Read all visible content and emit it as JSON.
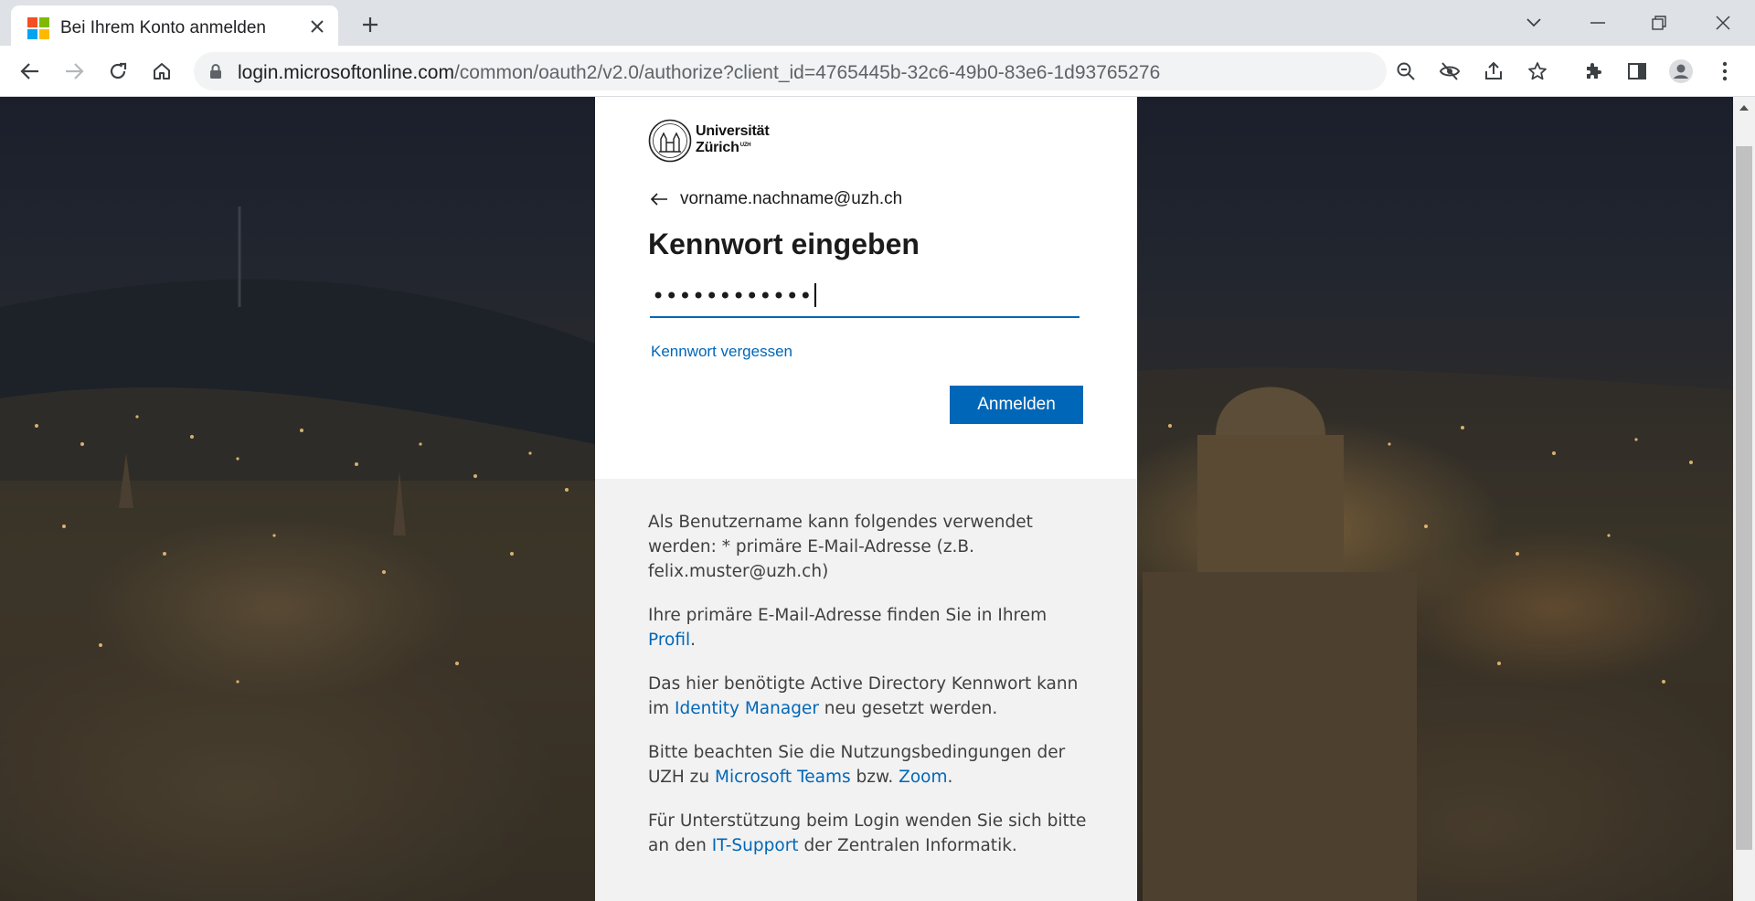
{
  "browser": {
    "tab_title": "Bei Ihrem Konto anmelden",
    "url_host": "login.microsoftonline.com",
    "url_path": "/common/oauth2/v2.0/authorize?client_id=4765445b-32c6-49b0-83e6-1d93765276ca&redirect_uri=https..."
  },
  "logo": {
    "line1": "Universität",
    "line2": "Zürich",
    "mark": "UZH"
  },
  "signin": {
    "email": "vorname.nachname@uzh.ch",
    "heading": "Kennwort eingeben",
    "password_masked": "••••••••••••",
    "forgot_link": "Kennwort vergessen",
    "submit_label": "Anmelden"
  },
  "info": {
    "p1": "Als Benutzername kann folgendes verwendet werden: * primäre E-Mail-Adresse (z.B. felix.muster@uzh.ch)",
    "p2_pre": "Ihre primäre E-Mail-Adresse finden Sie in Ihrem ",
    "p2_link": "Profil",
    "p2_post": ".",
    "p3_pre": "Das hier benötigte Active Directory Kennwort kann im ",
    "p3_link": "Identity Manager",
    "p3_post": " neu gesetzt werden.",
    "p4_pre": "Bitte beachten Sie die Nutzungsbedingungen der UZH zu ",
    "p4_link1": "Microsoft Teams",
    "p4_mid": " bzw. ",
    "p4_link2": "Zoom",
    "p4_post": ".",
    "p5_pre": "Für Unterstützung beim Login wenden Sie sich bitte an den ",
    "p5_link": "IT-Support",
    "p5_post": " der Zentralen Informatik."
  },
  "colors": {
    "accent": "#0067b8",
    "card_top": "#ffffff",
    "card_bottom": "#f2f2f2",
    "tabstrip": "#dee1e6"
  }
}
